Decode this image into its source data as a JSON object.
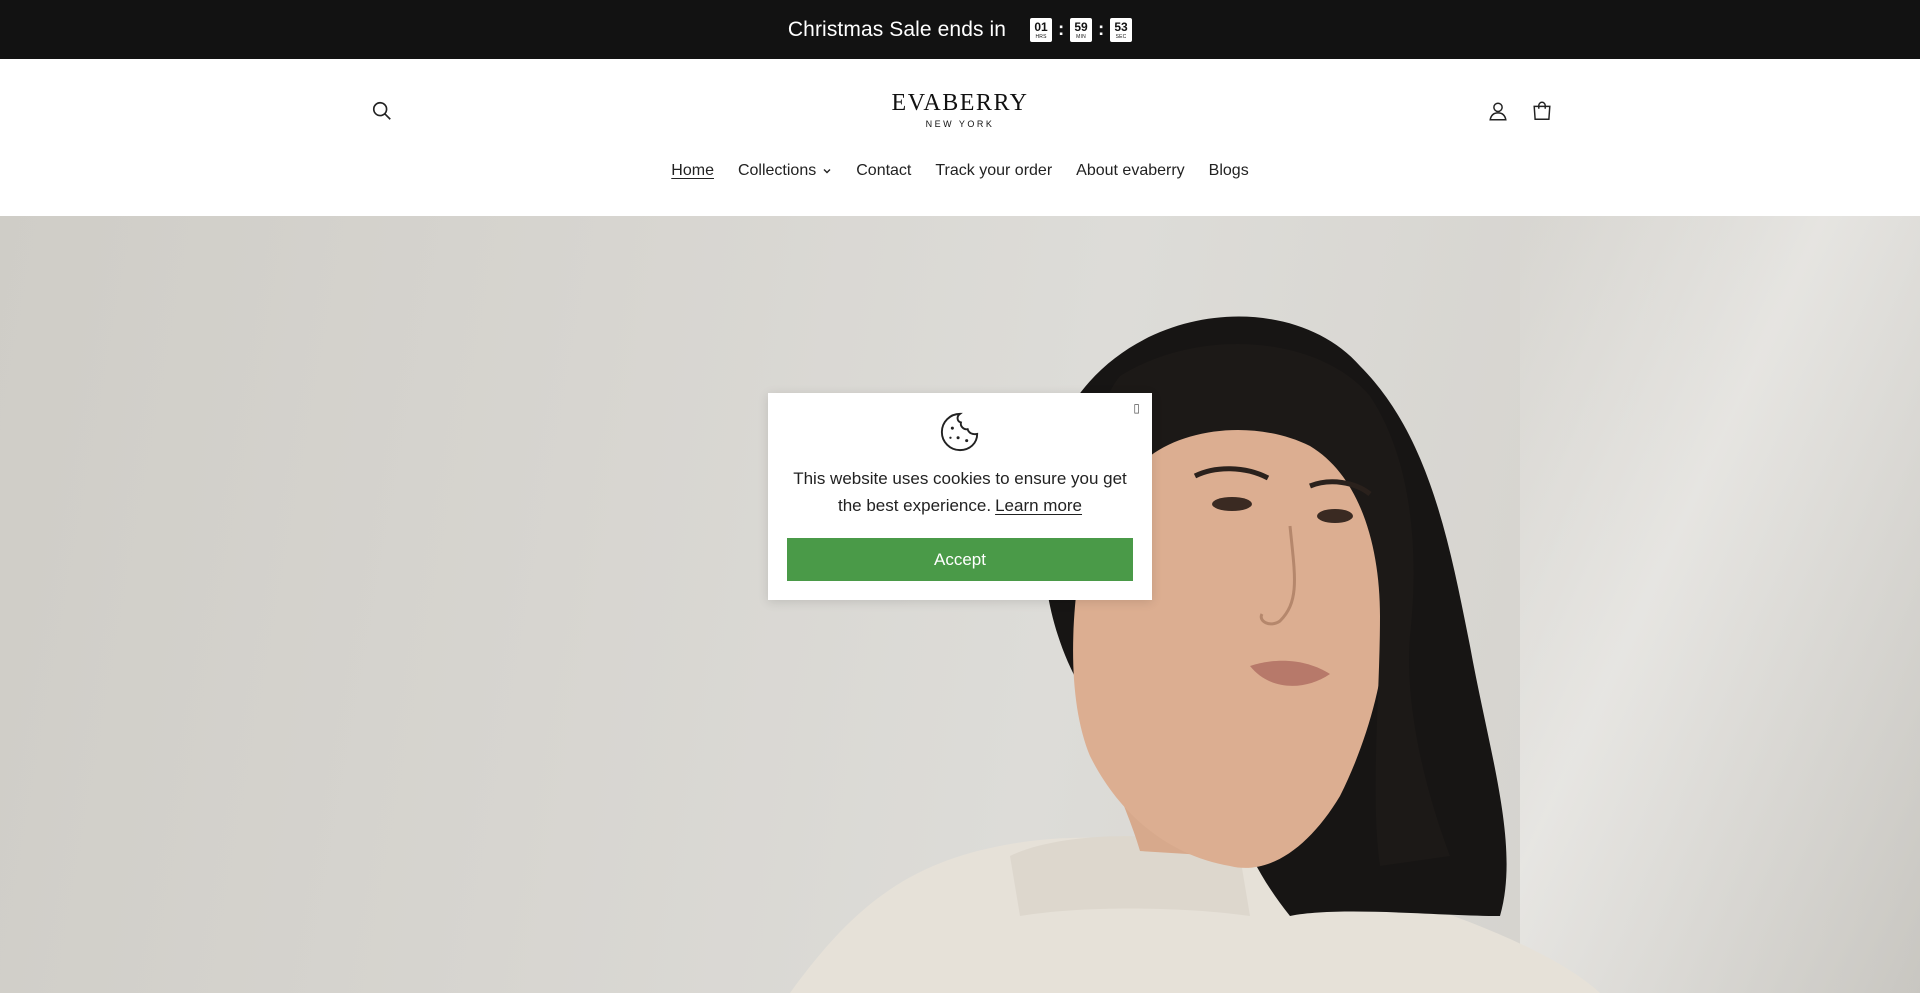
{
  "announcement": {
    "text": "Christmas Sale ends in",
    "timer": {
      "hours": "01",
      "hours_label": "HRS",
      "minutes": "59",
      "minutes_label": "MIN",
      "seconds": "53",
      "seconds_label": "SEC",
      "separator": ":"
    }
  },
  "header": {
    "logo": {
      "name": "EVABERRY",
      "tagline": "NEW YORK"
    },
    "icons": {
      "search": "search-icon",
      "account": "account-icon",
      "cart": "cart-icon"
    }
  },
  "nav": {
    "items": [
      {
        "label": "Home",
        "active": true
      },
      {
        "label": "Collections",
        "has_dropdown": true
      },
      {
        "label": "Contact"
      },
      {
        "label": "Track your order"
      },
      {
        "label": "About evaberry"
      },
      {
        "label": "Blogs"
      }
    ]
  },
  "cookie_banner": {
    "close_glyph": "▯",
    "icon": "cookie-icon",
    "message": "This website uses cookies to ensure you get the best experience.",
    "learn_more": "Learn more",
    "accept": "Accept",
    "accept_color": "#4a9a48"
  },
  "colors": {
    "announcement_bg": "#121212",
    "accent_green": "#4a9a48"
  }
}
